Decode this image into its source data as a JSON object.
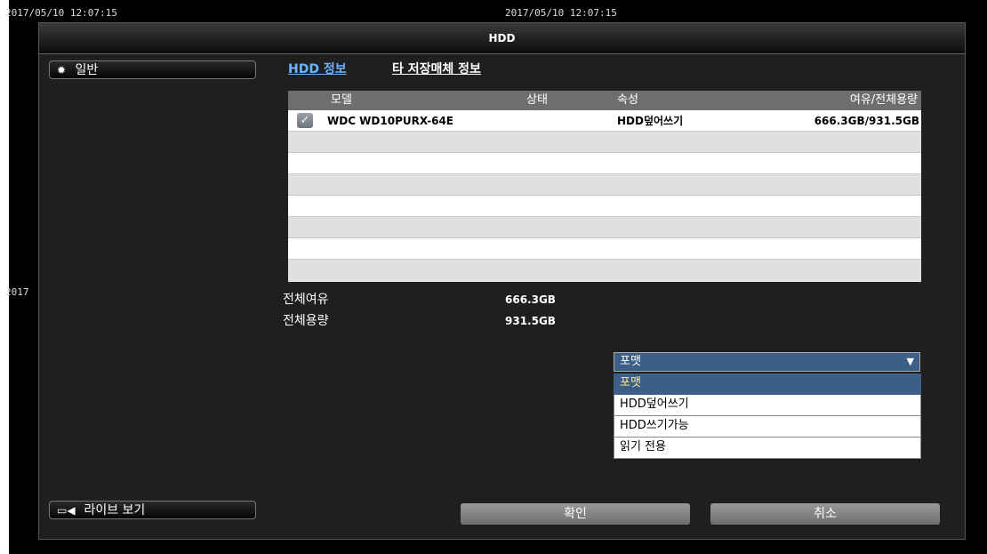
{
  "timestamps": {
    "left": "2017/05/10 12:07:15",
    "center": "2017/05/10 12:07:15",
    "side": "2017"
  },
  "window": {
    "title": "HDD"
  },
  "sidebar": {
    "general_label": "일반",
    "live_view_label": "라이브 보기"
  },
  "tabs": [
    {
      "label": "HDD 정보"
    },
    {
      "label": "타 저장매체 정보"
    }
  ],
  "table": {
    "headers": {
      "model": "모델",
      "status": "상태",
      "property": "속성",
      "capacity": "여유/전체용량"
    },
    "rows": [
      {
        "checked": true,
        "model": "WDC WD10PURX-64E",
        "status": "",
        "property": "HDD덮어쓰기",
        "capacity": "666.3GB/931.5GB"
      }
    ]
  },
  "summary": {
    "free_label": "전체여유",
    "free_value": "666.3GB",
    "total_label": "전체용량",
    "total_value": "931.5GB"
  },
  "dropdown": {
    "selected": "포맷",
    "options": [
      "포맷",
      "HDD덮어쓰기",
      "HDD쓰기가능",
      "읽기 전용"
    ]
  },
  "buttons": {
    "confirm": "확인",
    "cancel": "취소"
  },
  "colors": {
    "select_bg": "#3b5f86",
    "active_tab": "#6cb4ff",
    "highlight_text": "#ffef8a"
  }
}
